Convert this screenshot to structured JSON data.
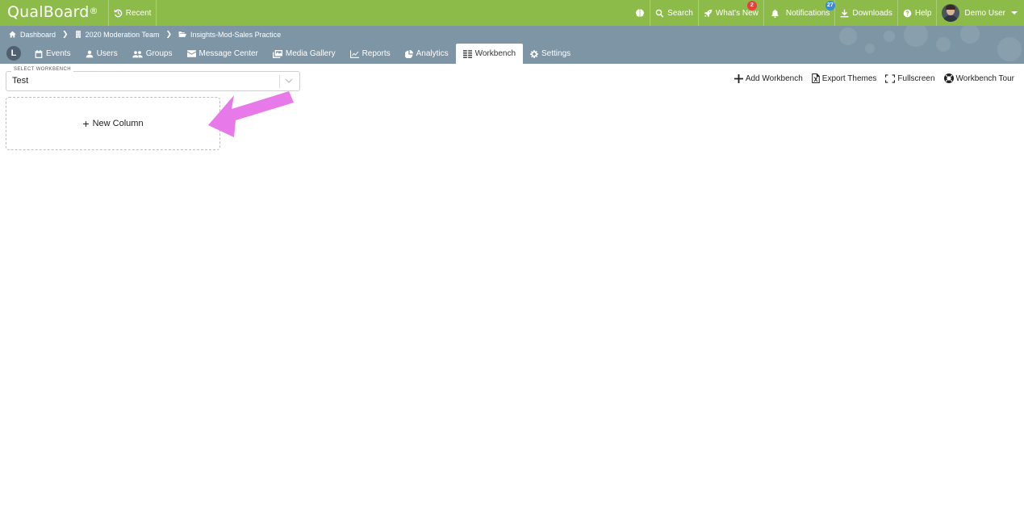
{
  "brand": {
    "name": "QualBoard",
    "mark": "®"
  },
  "topbar": {
    "recent": "Recent",
    "search": "Search",
    "whats_new": "What's New",
    "whats_new_count": "2",
    "notifications": "Notifications",
    "notifications_count": "27",
    "downloads": "Downloads",
    "help": "Help",
    "user": "Demo User"
  },
  "breadcrumb": [
    {
      "label": "Dashboard"
    },
    {
      "label": "2020 Moderation Team"
    },
    {
      "label": "Insights-Mod-Sales Practice"
    }
  ],
  "nav": {
    "logo": "L",
    "tabs": [
      {
        "label": "Events",
        "icon": "calendar-icon"
      },
      {
        "label": "Users",
        "icon": "user-icon"
      },
      {
        "label": "Groups",
        "icon": "group-icon"
      },
      {
        "label": "Message Center",
        "icon": "envelope-icon"
      },
      {
        "label": "Media Gallery",
        "icon": "images-icon"
      },
      {
        "label": "Reports",
        "icon": "line-chart-icon"
      },
      {
        "label": "Analytics",
        "icon": "pie-chart-icon"
      },
      {
        "label": "Workbench",
        "icon": "columns-icon",
        "active": true
      },
      {
        "label": "Settings",
        "icon": "gear-icon"
      }
    ]
  },
  "workbench": {
    "select_label": "SELECT WORKBENCH",
    "selected": "Test",
    "new_column": "New Column"
  },
  "toolbar": {
    "add_workbench": "Add Workbench",
    "export_themes": "Export Themes",
    "fullscreen": "Fullscreen",
    "tour": "Workbench Tour"
  },
  "colors": {
    "topbar": "#8dbb4a",
    "nav_band": "#7d95a5",
    "annotation_arrow": "#e879e8",
    "badge_red": "#e5403e",
    "badge_blue": "#3b8ad8"
  }
}
